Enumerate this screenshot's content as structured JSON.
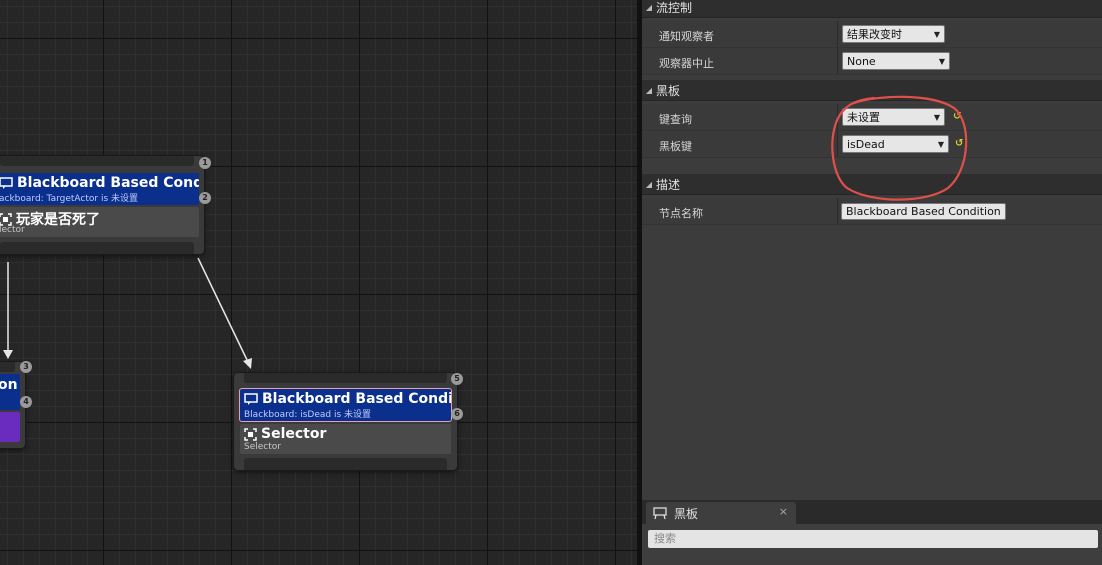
{
  "graph": {
    "node1": {
      "decorator_title": "Blackboard Based Condition",
      "decorator_sub": "ackboard: TargetActor is 未设置",
      "composite_title": "玩家是否死了",
      "composite_sub": "lector",
      "index_top": "1",
      "index_deco": "2"
    },
    "node2": {
      "decorator_title": "on",
      "index_top": "3",
      "index_deco": "4"
    },
    "node3": {
      "decorator_title": "Blackboard Based Condition",
      "decorator_sub": "Blackboard: isDead is 未设置",
      "composite_title": "Selector",
      "composite_sub": "Selector",
      "index_top": "5",
      "index_deco": "6"
    }
  },
  "details": {
    "flow_control": {
      "header": "流控制",
      "notify_observer": {
        "label": "通知观察者",
        "value": "结果改变时"
      },
      "observer_aborts": {
        "label": "观察器中止",
        "value": "None"
      }
    },
    "blackboard": {
      "header": "黑板",
      "key_query": {
        "label": "键查询",
        "value": "未设置"
      },
      "blackboard_key": {
        "label": "黑板键",
        "value": "isDead"
      }
    },
    "description": {
      "header": "描述",
      "node_name": {
        "label": "节点名称",
        "value": "Blackboard Based Condition"
      }
    }
  },
  "bottom_panel": {
    "tab_label": "黑板",
    "close": "×",
    "search_placeholder": "搜索"
  },
  "colors": {
    "decorator_blue": "#0b2f8c",
    "annotation_red": "#e0504a",
    "composite_purple": "#6a2bbf"
  }
}
